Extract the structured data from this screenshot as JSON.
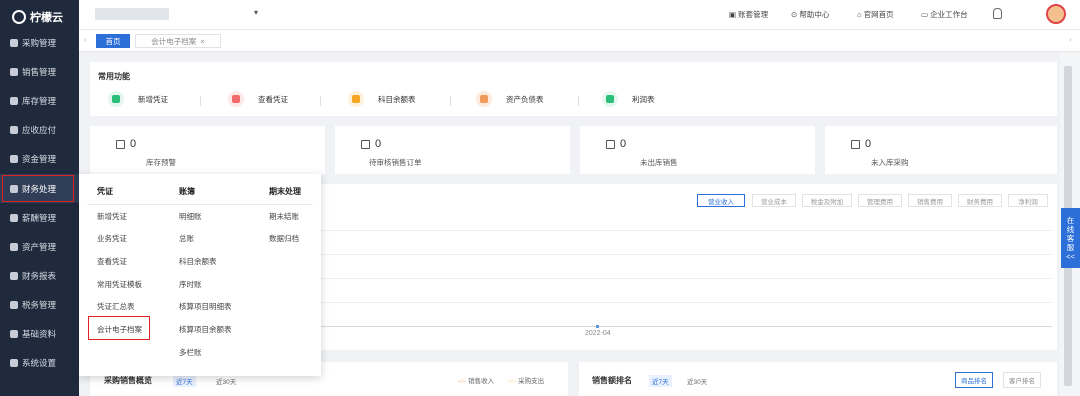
{
  "app": {
    "logo": "柠檬云"
  },
  "sidebar": {
    "items": [
      {
        "label": "采购管理"
      },
      {
        "label": "销售管理"
      },
      {
        "label": "库存管理"
      },
      {
        "label": "应收应付"
      },
      {
        "label": "资金管理"
      },
      {
        "label": "财务处理"
      },
      {
        "label": "薪酬管理"
      },
      {
        "label": "资产管理"
      },
      {
        "label": "财务报表"
      },
      {
        "label": "税务管理"
      },
      {
        "label": "基础资料"
      },
      {
        "label": "系统设置"
      }
    ]
  },
  "header": {
    "links": [
      "账套管理",
      "帮助中心",
      "官网首页",
      "企业工作台"
    ]
  },
  "tabs": {
    "home": "首页",
    "current": "会计电子档案",
    "close": "×"
  },
  "quick": {
    "title": "常用功能",
    "items": [
      {
        "label": "新增凭证",
        "color": "#2bbf7a"
      },
      {
        "label": "查看凭证",
        "color": "#f26b6b"
      },
      {
        "label": "科目余额表",
        "color": "#f5a623"
      },
      {
        "label": "资产负债表",
        "color": "#f09a5a"
      },
      {
        "label": "利润表",
        "color": "#2bbf7a"
      }
    ]
  },
  "stats": [
    {
      "value": "0",
      "label": "库存预警"
    },
    {
      "value": "0",
      "label": "待审核销售订单"
    },
    {
      "value": "0",
      "label": "未出库销售"
    },
    {
      "value": "0",
      "label": "未入库采购"
    }
  ],
  "chart": {
    "tabs": [
      "营业收入",
      "营业成本",
      "税金及附加",
      "管理费用",
      "销售费用",
      "财务费用",
      "净利润"
    ],
    "xlabel": "2022-04"
  },
  "bottom": {
    "left": {
      "title": "采购销售概览",
      "range1": "近7天",
      "range2": "近30天",
      "legend1": "销售收入",
      "legend2": "采购支出"
    },
    "right": {
      "title": "销售额排名",
      "range1": "近7天",
      "range2": "近30天",
      "btn1": "商品排名",
      "btn2": "客户排名"
    }
  },
  "dropdown": {
    "headers": [
      "凭证",
      "账簿",
      "期末处理"
    ],
    "col1": [
      "新增凭证",
      "业务凭证",
      "查看凭证",
      "常用凭证模板",
      "凭证汇总表",
      "会计电子档案"
    ],
    "col2": [
      "明细账",
      "总账",
      "科目余额表",
      "序时账",
      "核算项目明细表",
      "核算项目余额表",
      "多栏账"
    ],
    "col3": [
      "期末结账",
      "数据归档"
    ]
  },
  "service": [
    "在",
    "线",
    "客",
    "服",
    "<<"
  ]
}
